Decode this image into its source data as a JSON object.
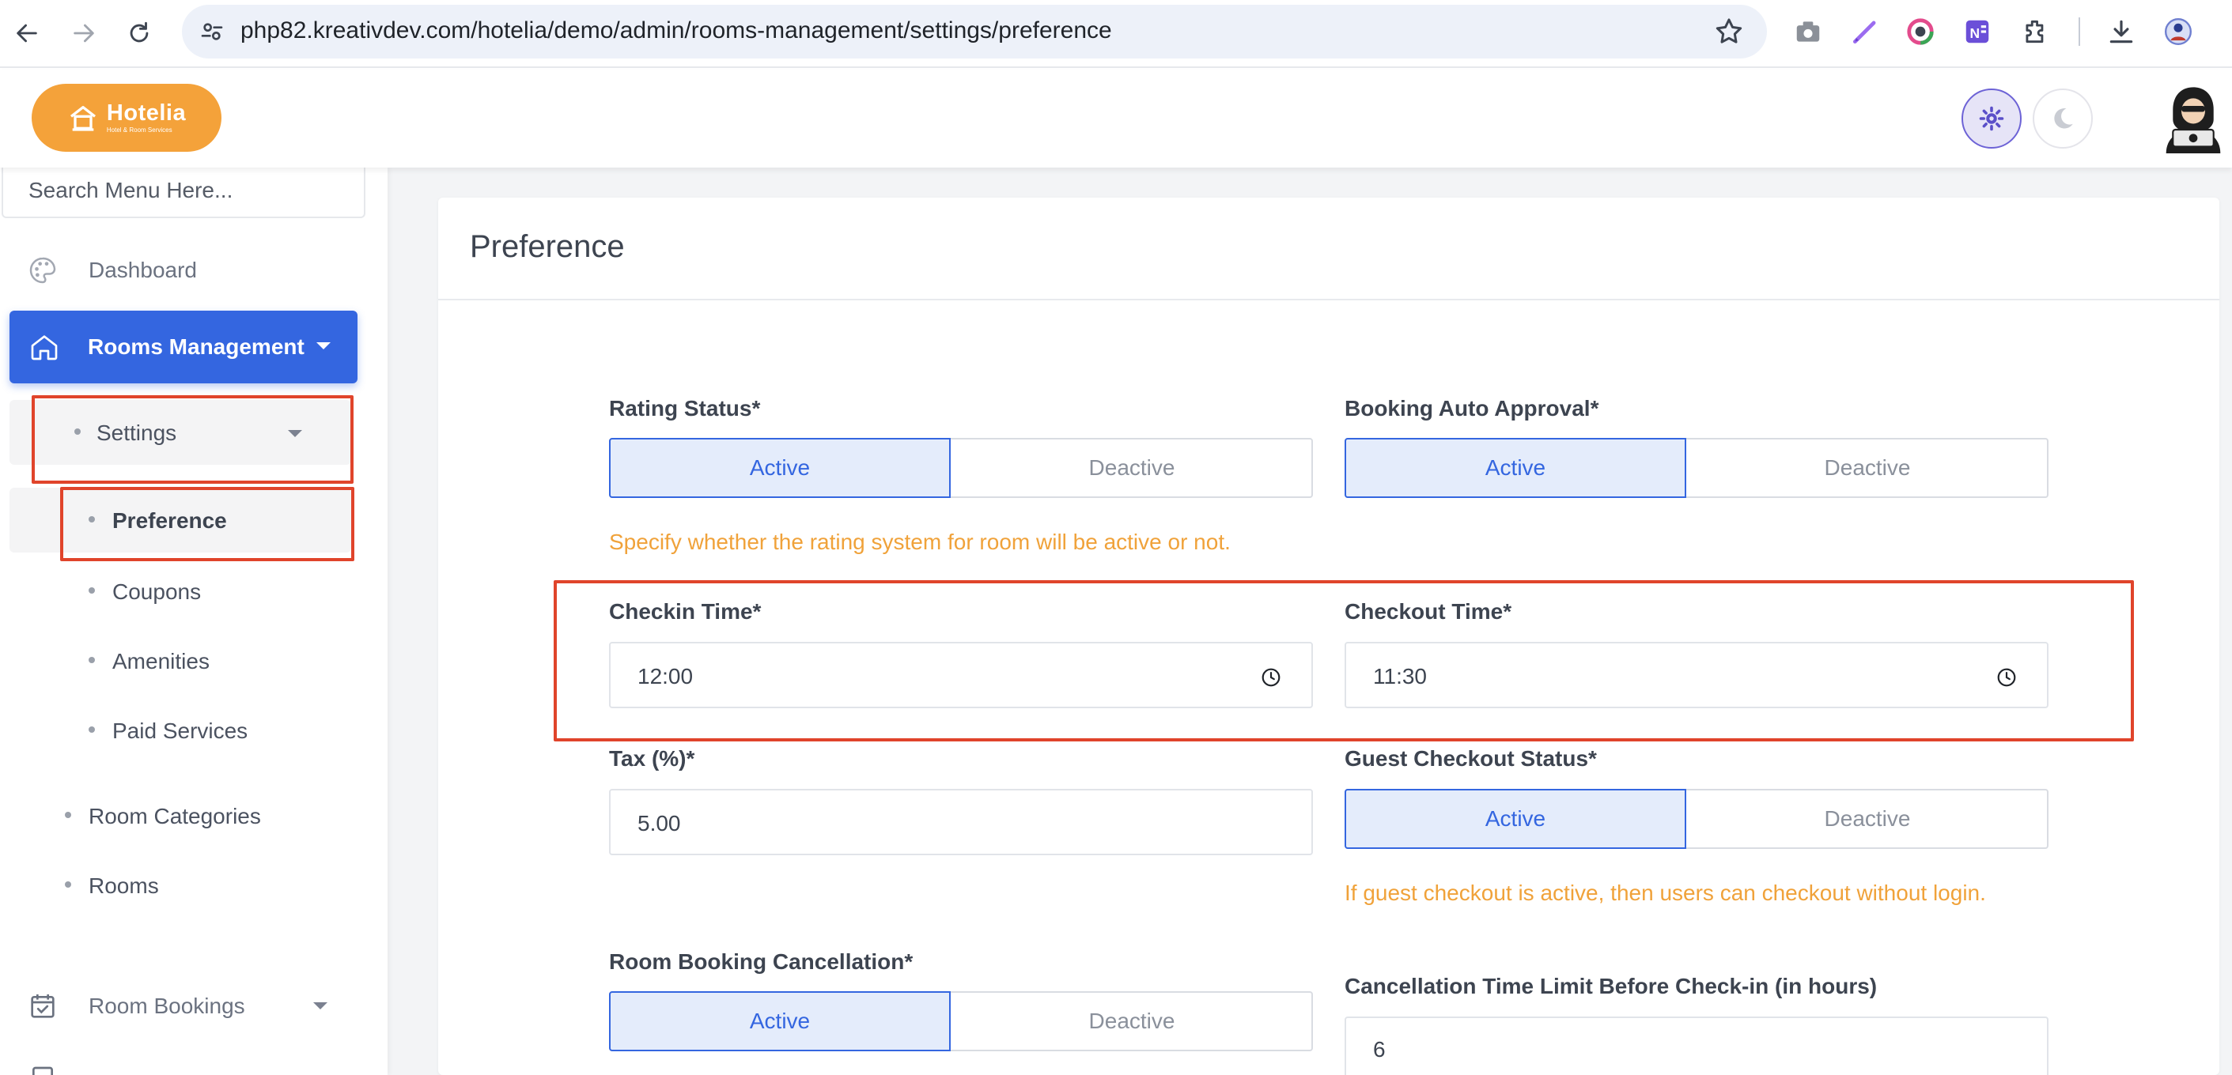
{
  "browser": {
    "url": "php82.kreativdev.com/hotelia/demo/admin/rooms-management/settings/preference"
  },
  "brand": {
    "name": "Hotelia",
    "tagline": "Hotel & Room Services",
    "accent_color": "#f4a23a"
  },
  "colors": {
    "primary": "#3466e0",
    "hint": "#f0a23a",
    "highlight_box": "#e0442b"
  },
  "sidebar": {
    "search_placeholder": "Search Menu Here...",
    "dashboard": "Dashboard",
    "rooms_management": "Rooms Management",
    "settings": "Settings",
    "preference": "Preference",
    "coupons": "Coupons",
    "amenities": "Amenities",
    "paid_services": "Paid Services",
    "room_categories": "Room Categories",
    "rooms": "Rooms",
    "room_bookings": "Room Bookings"
  },
  "page": {
    "title": "Preference"
  },
  "form": {
    "rating_status": {
      "label": "Rating Status*",
      "active": "Active",
      "deactive": "Deactive",
      "selected": "Active",
      "hint": "Specify whether the rating system for room will be active or not."
    },
    "booking_auto_approval": {
      "label": "Booking Auto Approval*",
      "active": "Active",
      "deactive": "Deactive",
      "selected": "Active"
    },
    "checkin_time": {
      "label": "Checkin Time*",
      "value": "12:00"
    },
    "checkout_time": {
      "label": "Checkout Time*",
      "value": "11:30"
    },
    "tax": {
      "label": "Tax (%)*",
      "value": "5.00"
    },
    "guest_checkout_status": {
      "label": "Guest Checkout Status*",
      "active": "Active",
      "deactive": "Deactive",
      "selected": "Active",
      "hint": "If guest checkout is active, then users can checkout without login."
    },
    "room_booking_cancellation": {
      "label": "Room Booking Cancellation*",
      "active": "Active",
      "deactive": "Deactive",
      "selected": "Active"
    },
    "cancellation_time_limit": {
      "label": "Cancellation Time Limit Before Check-in (in hours)",
      "value": "6"
    }
  }
}
